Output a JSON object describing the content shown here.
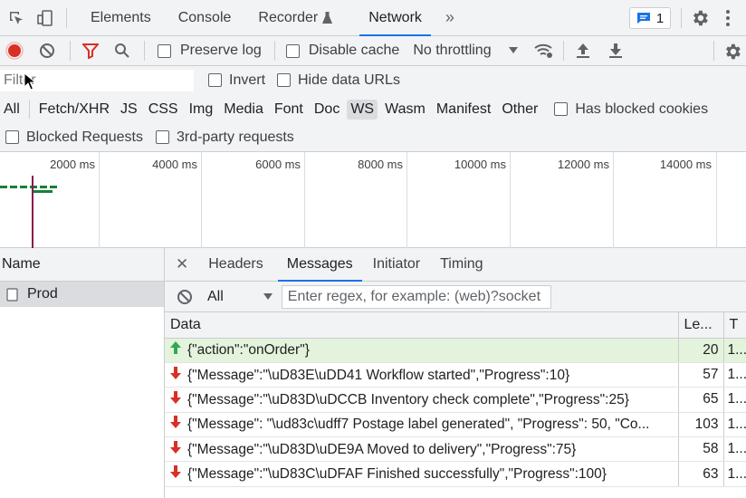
{
  "topbar": {
    "tabs": [
      {
        "label": "Elements"
      },
      {
        "label": "Console"
      },
      {
        "label": "Recorder"
      },
      {
        "label": "Network"
      }
    ],
    "more_tabs_icon": "double-chevron-right",
    "issues_count": "1"
  },
  "toolbar": {
    "preserve_log": "Preserve log",
    "disable_cache": "Disable cache",
    "throttling": "No throttling"
  },
  "filter": {
    "placeholder": "Filter",
    "invert": "Invert",
    "hide_data_urls": "Hide data URLs",
    "types": [
      "All",
      "Fetch/XHR",
      "JS",
      "CSS",
      "Img",
      "Media",
      "Font",
      "Doc",
      "WS",
      "Wasm",
      "Manifest",
      "Other"
    ],
    "active_type": "WS",
    "has_blocked_cookies": "Has blocked cookies",
    "blocked_requests": "Blocked Requests",
    "third_party": "3rd-party requests"
  },
  "timeline": {
    "labels": [
      "2000 ms",
      "4000 ms",
      "6000 ms",
      "8000 ms",
      "10000 ms",
      "12000 ms",
      "14000 ms"
    ]
  },
  "requests": {
    "header": "Name",
    "items": [
      {
        "name": "Prod"
      }
    ]
  },
  "details": {
    "tabs": [
      "Headers",
      "Messages",
      "Initiator",
      "Timing"
    ],
    "active_tab": "Messages",
    "message_filter": "All",
    "regex_placeholder": "Enter regex, for example: (web)?socket",
    "columns": {
      "data": "Data",
      "length": "Le...",
      "time": "T"
    },
    "messages": [
      {
        "direction": "sent",
        "data": "{\"action\":\"onOrder\"}",
        "length": "20",
        "time": "1..."
      },
      {
        "direction": "received",
        "data": "{\"Message\":\"\\uD83E\\uDD41 Workflow started\",\"Progress\":10}",
        "length": "57",
        "time": "1..."
      },
      {
        "direction": "received",
        "data": "{\"Message\":\"\\uD83D\\uDCCB Inventory check complete\",\"Progress\":25}",
        "length": "65",
        "time": "1..."
      },
      {
        "direction": "received",
        "data": "{\"Message\": \"\\ud83c\\udff7 Postage label generated\", \"Progress\": 50, \"Co...",
        "length": "103",
        "time": "1..."
      },
      {
        "direction": "received",
        "data": "{\"Message\":\"\\uD83D\\uDE9A Moved to delivery\",\"Progress\":75}",
        "length": "58",
        "time": "1..."
      },
      {
        "direction": "received",
        "data": "{\"Message\":\"\\uD83C\\uDFAF Finished successfully\",\"Progress\":100}",
        "length": "63",
        "time": "1..."
      }
    ]
  },
  "colors": {
    "record": "#d93025",
    "filter_active": "#d93025",
    "accent": "#1a73e8",
    "sent_row": "#e4f3dc",
    "sent_arrow": "#34a853",
    "received_arrow": "#d93025"
  }
}
